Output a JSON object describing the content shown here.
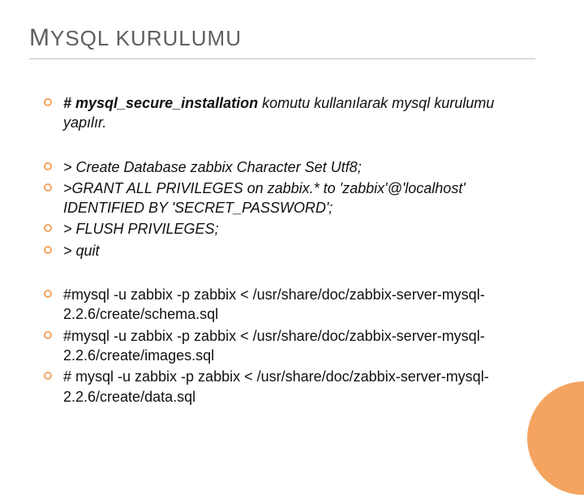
{
  "title_parts": {
    "p1": "M",
    "p2": "YSQL",
    "p3": " KURULUMU"
  },
  "groups": [
    {
      "items": [
        {
          "runs": [
            {
              "text": "# mysql_secure_installation",
              "bold": true,
              "italic": true
            },
            {
              "text": "  komutu kullanılarak mysql kurulumu yapılır.",
              "italic": true
            }
          ]
        }
      ]
    },
    {
      "items": [
        {
          "runs": [
            {
              "text": "> Create Database zabbix Character Set Utf8;",
              "italic": true
            }
          ]
        },
        {
          "runs": [
            {
              "text": ">GRANT ALL PRIVILEGES on zabbix.* to 'zabbix'@'localhost' IDENTIFIED BY 'SECRET_PASSWORD';",
              "italic": true
            }
          ]
        },
        {
          "runs": [
            {
              "text": "> FLUSH PRIVILEGES;",
              "italic": true
            }
          ]
        },
        {
          "runs": [
            {
              "text": "> quit",
              "italic": true
            }
          ]
        }
      ]
    },
    {
      "items": [
        {
          "runs": [
            {
              "text": "#mysql -u zabbix -p zabbix < /usr/share/doc/zabbix-server-mysql-2.2.6/create/schema.sql"
            }
          ]
        },
        {
          "runs": [
            {
              "text": "#mysql -u zabbix -p zabbix < /usr/share/doc/zabbix-server-mysql-2.2.6/create/images.sql"
            }
          ]
        },
        {
          "runs": [
            {
              "text": "# mysql -u zabbix -p zabbix < /usr/share/doc/zabbix-server-mysql-2.2.6/create/data.sql"
            }
          ]
        }
      ]
    }
  ]
}
